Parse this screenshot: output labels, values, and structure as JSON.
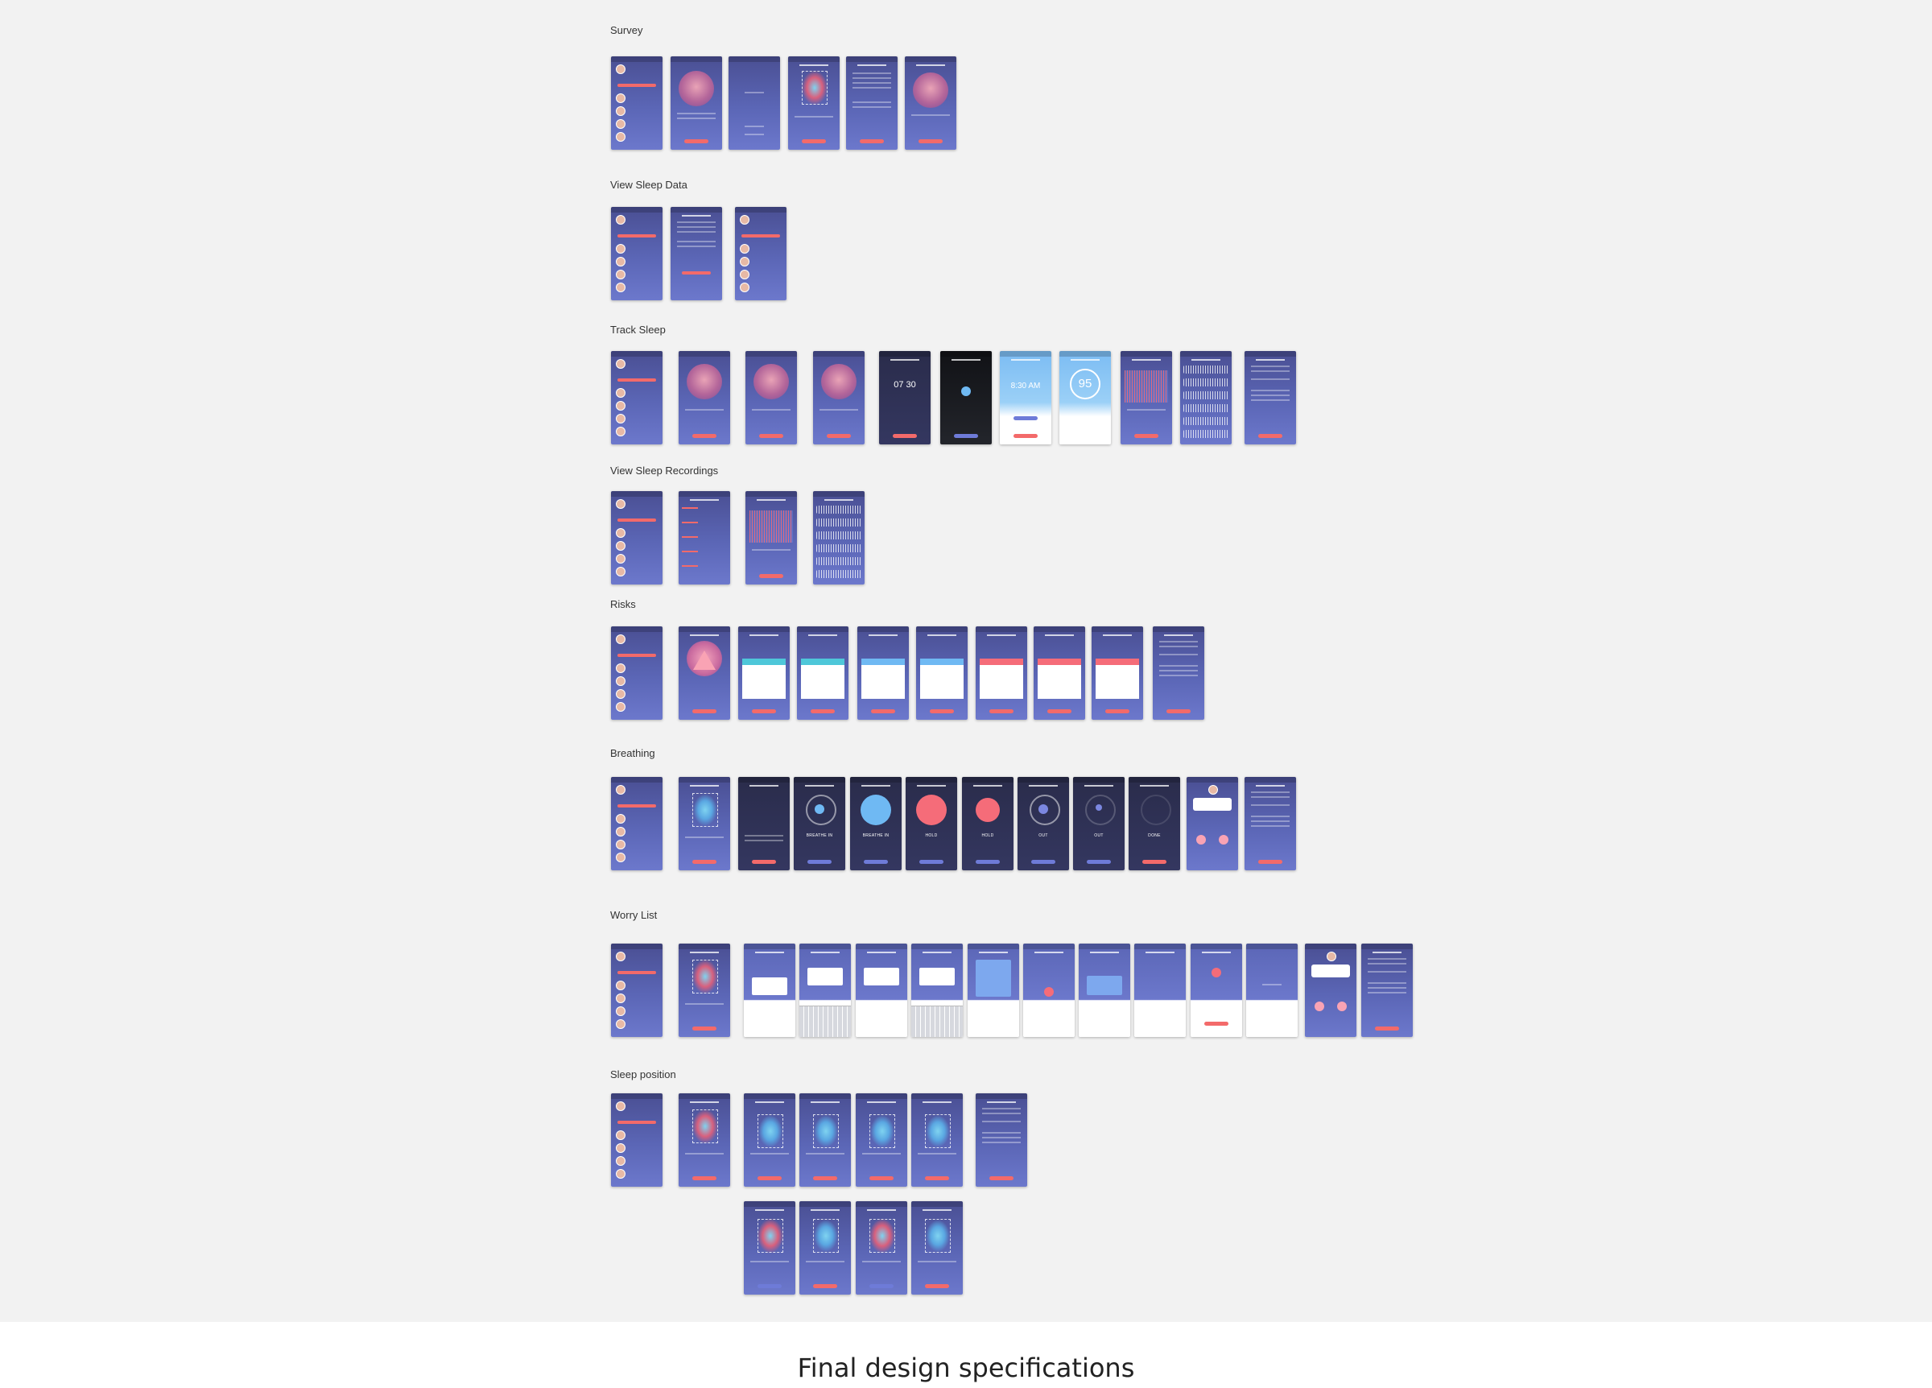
{
  "sections": [
    {
      "label": "Survey"
    },
    {
      "label": "View Sleep Data"
    },
    {
      "label": "Track Sleep"
    },
    {
      "label": "View Sleep Recordings"
    },
    {
      "label": "Risks"
    },
    {
      "label": "Breathing"
    },
    {
      "label": "Worry List"
    },
    {
      "label": "Sleep position"
    }
  ],
  "screen_text": {
    "alarm_time": "07 30",
    "alarm_time_light": "8:30 AM",
    "sleep_score": "95",
    "breathe_in": "BREATHE IN",
    "hold": "HOLD",
    "out": "OUT",
    "done": "DONE"
  },
  "caption": "Final design specifications",
  "colors": {
    "screen_purple": "#5b66b6",
    "accent_coral": "#f36a6a",
    "accent_blue": "#6fb9f3",
    "board_bg": "#f2f2f2"
  }
}
